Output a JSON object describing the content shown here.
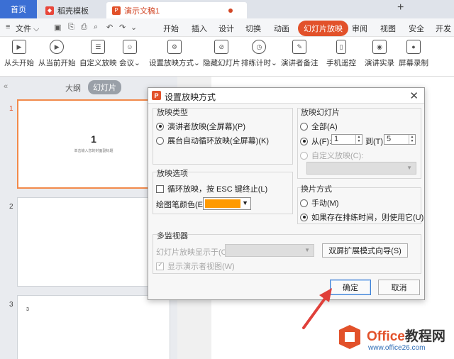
{
  "tabs": {
    "home": "首页",
    "templates": "稻壳模板",
    "document": "演示文稿1"
  },
  "menu": {
    "file": "文件",
    "items": [
      "开始",
      "插入",
      "设计",
      "切换",
      "动画",
      "幻灯片放映",
      "审阅",
      "视图",
      "安全",
      "开发"
    ],
    "active": "幻灯片放映"
  },
  "ribbon": {
    "buttons": [
      "从头开始",
      "从当前开始",
      "自定义放映",
      "会议",
      "设置放映方式",
      "隐藏幻灯片",
      "排练计时",
      "演讲者备注",
      "手机遥控",
      "演讲实录",
      "屏幕录制"
    ]
  },
  "left_panel": {
    "outline_tab": "大纲",
    "slides_tab": "幻灯片",
    "slide_numbers": [
      "1",
      "2",
      "3"
    ],
    "slide1_title": "1",
    "slide1_subtitle": "单击输入您的封面副标题",
    "slide3_text": "3"
  },
  "dialog": {
    "title": "设置放映方式",
    "show_type": {
      "label": "放映类型",
      "presenter": "演讲者放映(全屏幕)(P)",
      "kiosk": "展台自动循环放映(全屏幕)(K)"
    },
    "slides": {
      "label": "放映幻灯片",
      "all": "全部(A)",
      "from": "从(F):",
      "from_value": "1",
      "to": "到(T):",
      "to_value": "5",
      "custom": "自定义放映(C):"
    },
    "options": {
      "label": "放映选项",
      "loop": "循环放映，按 ESC 键终止(L)",
      "pen_color": "绘图笔颜色(E):",
      "pen_color_value": "#ff9a00"
    },
    "advance": {
      "label": "换片方式",
      "manual": "手动(M)",
      "timings": "如果存在排练时间，则使用它(U)"
    },
    "monitors": {
      "label": "多监视器",
      "show_on": "幻灯片放映显示于(O):",
      "wizard": "双屏扩展模式向导(S)",
      "presenter_view": "显示演示者视图(W)"
    },
    "ok": "确定",
    "cancel": "取消"
  },
  "watermark": {
    "brand_office": "Office",
    "brand_rest": "教程网",
    "url": "www.office26.com"
  },
  "colors": {
    "accent": "#e2512a",
    "home_tab": "#3b6fd4",
    "arrow": "#e0403a"
  }
}
